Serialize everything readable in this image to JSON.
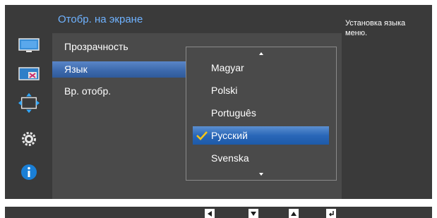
{
  "header": {
    "title": "Отобр. на экране"
  },
  "menu": {
    "items": [
      {
        "label": "Прозрачность"
      },
      {
        "label": "Язык"
      },
      {
        "label": "Вр. отобр."
      }
    ]
  },
  "dropdown": {
    "options": [
      {
        "label": "Magyar"
      },
      {
        "label": "Polski"
      },
      {
        "label": "Português"
      },
      {
        "label": "Русский"
      },
      {
        "label": "Svenska"
      }
    ],
    "selected_label": "Русский"
  },
  "help": {
    "text": "Установка языка меню."
  },
  "sidebar": {
    "icons": [
      "monitor-icon",
      "picture-in-picture-icon",
      "position-arrows-icon",
      "gear-icon",
      "info-icon"
    ],
    "selected_icon": "position-arrows-icon"
  },
  "navbar": {
    "buttons": [
      "left-arrow-icon",
      "down-arrow-icon",
      "up-arrow-icon",
      "enter-icon"
    ]
  },
  "colors": {
    "accent_title": "#6fb2ff",
    "selection_blue": "#2a67b8",
    "info_blue": "#1a7fd6",
    "panel_bg": "#4a4a4a"
  }
}
